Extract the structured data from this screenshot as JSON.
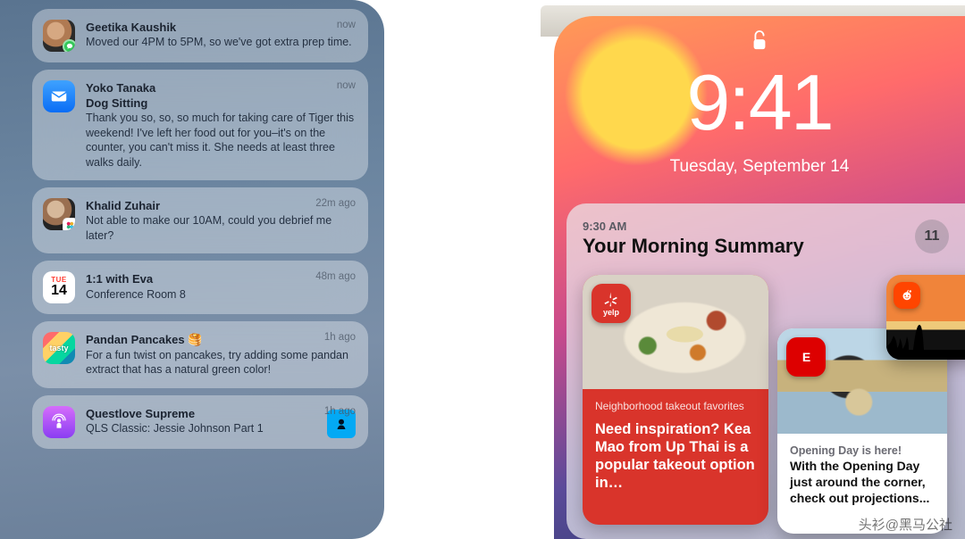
{
  "left_notifications": [
    {
      "icon": "avatar1",
      "title": "Geetika Kaushik",
      "sub": "",
      "msg": "Moved our 4PM to 5PM, so we've got extra prep time.",
      "time": "now"
    },
    {
      "icon": "mail",
      "title": "Yoko Tanaka",
      "sub": "Dog Sitting",
      "msg": "Thank you so, so, so much for taking care of Tiger this weekend! I've left her food out for you–it's on the counter, you can't miss it. She needs at least three walks daily.",
      "time": "now"
    },
    {
      "icon": "avatar2",
      "title": "Khalid Zuhair",
      "sub": "",
      "msg": "Not able to make our 10AM, could you debrief me later?",
      "time": "22m ago"
    },
    {
      "icon": "cal",
      "title": "1:1 with Eva",
      "sub": "",
      "msg": "Conference Room 8",
      "time": "48m ago"
    },
    {
      "icon": "tasty",
      "title": "Pandan Pancakes 🥞",
      "sub": "",
      "msg": "For a fun twist on pancakes, try adding some pandan extract that has a natural green color!",
      "time": "1h ago"
    },
    {
      "icon": "podcast",
      "title": "Questlove Supreme",
      "sub": "",
      "msg": "QLS Classic: Jessie Johnson Part 1",
      "time": "1h ago",
      "thumb": true
    }
  ],
  "cal_icon": {
    "dow": "TUE",
    "day": "14"
  },
  "lock": {
    "time": "9:41",
    "date": "Tuesday, September 14"
  },
  "summary": {
    "time": "9:30 AM",
    "title": "Your Morning Summary",
    "count": "11",
    "yelp": {
      "app": "yelp",
      "eyebrow": "Neighborhood takeout favorites",
      "headline": "Need inspiration? Kea Mao from Up Thai is a popular takeout option in…"
    },
    "espn": {
      "app": "E",
      "eyebrow": "Opening Day is here!",
      "headline": "With the Opening Day just around the corner, check out projections..."
    }
  },
  "watermark": "头衫@黑马公社"
}
